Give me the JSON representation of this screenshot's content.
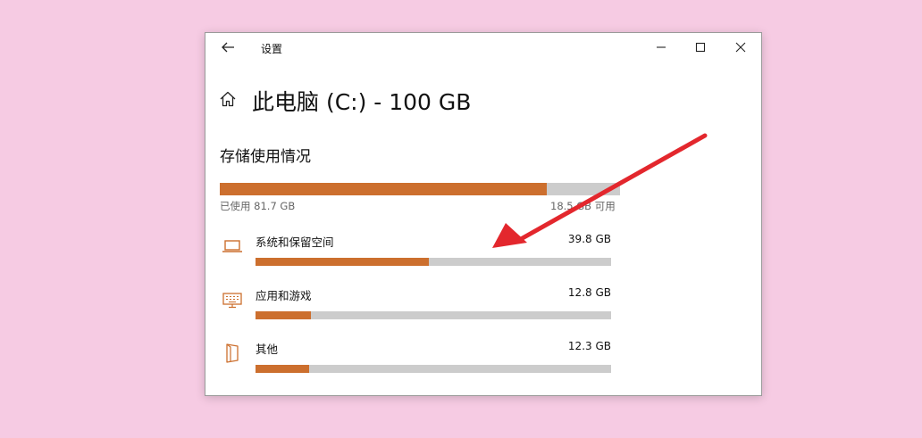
{
  "window": {
    "title": "设置"
  },
  "page": {
    "title": "此电脑 (C:) - 100 GB"
  },
  "storage": {
    "section_title": "存储使用情况",
    "used_label": "已使用 81.7 GB",
    "free_label": "18.5 GB 可用",
    "used_fraction": 0.817,
    "accent_color": "#cc6f2e",
    "track_color": "#cccccc"
  },
  "categories": [
    {
      "label": "系统和保留空间",
      "size": "39.8 GB",
      "fraction": 0.487,
      "icon": "laptop-icon"
    },
    {
      "label": "应用和游戏",
      "size": "12.8 GB",
      "fraction": 0.157,
      "icon": "keyboard-icon"
    },
    {
      "label": "其他",
      "size": "12.3 GB",
      "fraction": 0.151,
      "icon": "document-icon"
    }
  ],
  "annotation": {
    "arrow_color": "#e3272d"
  }
}
